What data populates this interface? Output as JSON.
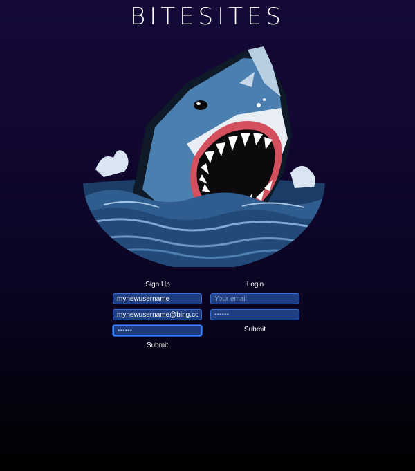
{
  "header": {
    "title": "BITESITES"
  },
  "hero": {
    "icon": "shark-illustration"
  },
  "signup": {
    "heading": "Sign Up",
    "username_value": "mynewusername",
    "email_value": "mynewusername@bing.com",
    "password_value": "••••••",
    "submit_label": "Submit"
  },
  "login": {
    "heading": "Login",
    "email_placeholder": "Your email",
    "password_placeholder": "••••••",
    "submit_label": "Submit"
  },
  "colors": {
    "background_top": "#150a38",
    "background_bottom": "#000000",
    "input_background": "#1f3f82",
    "input_border": "#3a6fd8",
    "focus_border": "#3f86ff",
    "shark_blue": "#4a7fb0"
  }
}
